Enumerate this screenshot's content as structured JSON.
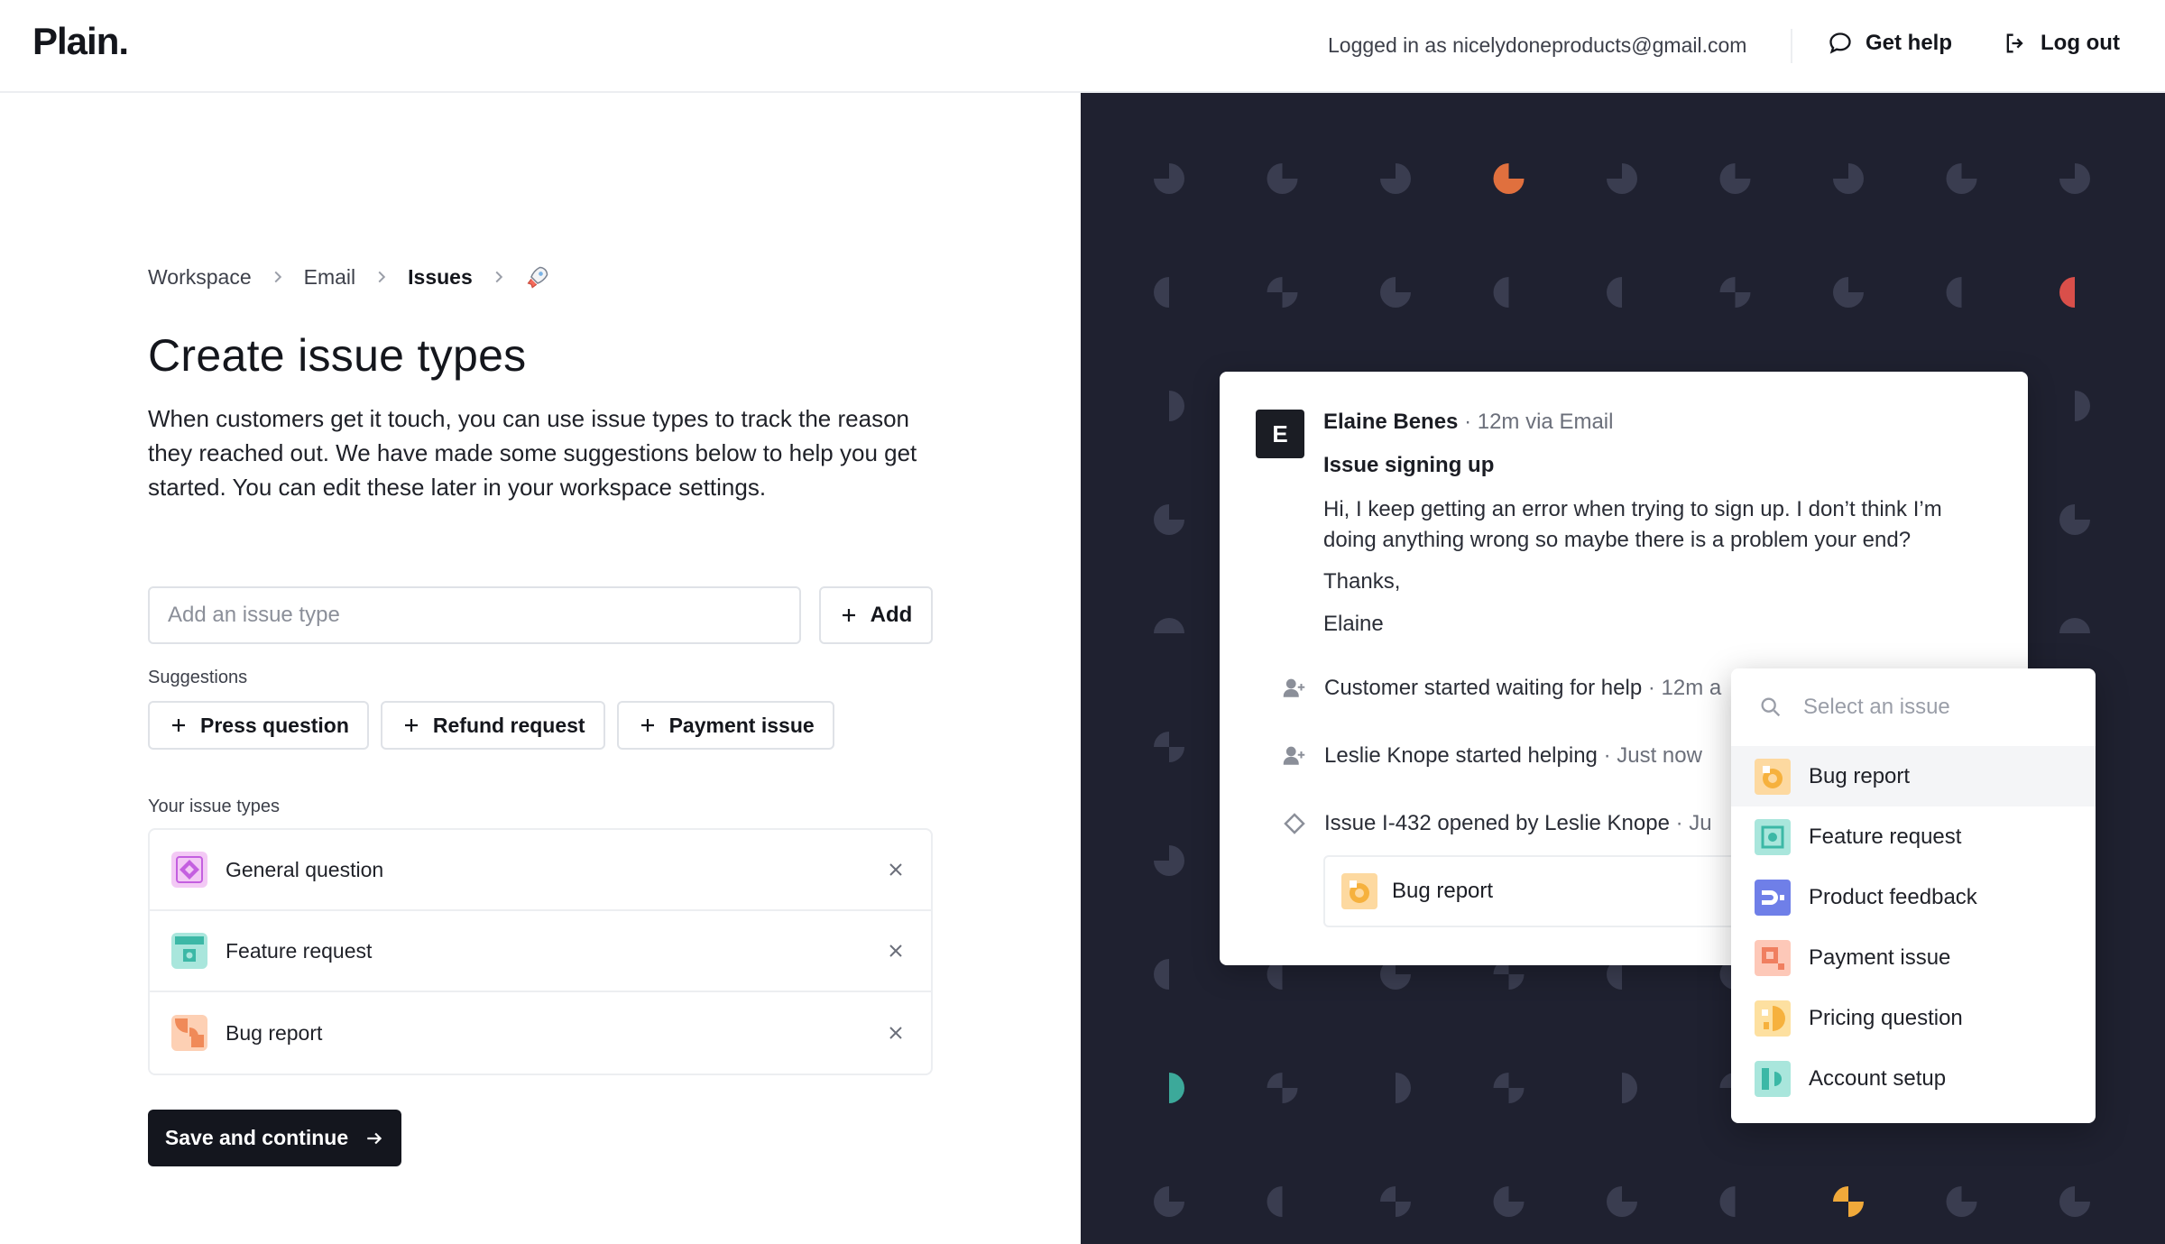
{
  "header": {
    "logo": "Plain.",
    "logged_in": "Logged in as nicelydoneproducts@gmail.com",
    "help_label": "Get help",
    "logout_label": "Log out"
  },
  "breadcrumb": {
    "items": [
      "Workspace",
      "Email",
      "Issues"
    ],
    "last_icon": "rocket-icon"
  },
  "main": {
    "title": "Create issue types",
    "description": "When customers get it touch, you can use issue types to track the reason they reached out. We have made some suggestions below to help you get started. You can edit these later in your workspace settings.",
    "input_placeholder": "Add an issue type",
    "add_label": "Add",
    "suggestions_label": "Suggestions",
    "suggestions": [
      "Press question",
      "Refund request",
      "Payment issue"
    ],
    "your_types_label": "Your issue types",
    "types": [
      {
        "label": "General question",
        "color": "#f3c9f5",
        "accent": "#c45fe0"
      },
      {
        "label": "Feature request",
        "color": "#a9e6dc",
        "accent": "#3cb8a6"
      },
      {
        "label": "Bug report",
        "color": "#fdd0b4",
        "accent": "#f08a58"
      }
    ],
    "save_label": "Save and continue"
  },
  "conversation": {
    "avatar_letter": "E",
    "sender": "Elaine Benes",
    "sender_meta": "· 12m via Email",
    "subject": "Issue signing up",
    "body": [
      "Hi, I keep getting an error when trying to sign up. I don’t think I’m doing anything wrong so maybe there is a problem your end?",
      "Thanks,",
      "Elaine"
    ],
    "timeline": [
      {
        "text": "Customer started waiting for help",
        "meta": "· 12m a",
        "icon": "user-plus-icon"
      },
      {
        "text": "Leslie Knope started helping",
        "meta": "· Just now",
        "icon": "user-plus-icon"
      },
      {
        "text": "Issue I-432 opened by Leslie Knope",
        "meta": "· Ju",
        "icon": "diamond-icon"
      }
    ],
    "issue_pill": "Bug report"
  },
  "dropdown": {
    "placeholder": "Select an issue",
    "items": [
      {
        "label": "Bug report",
        "color": "#fdd9a0",
        "accent": "#f6b13d"
      },
      {
        "label": "Feature request",
        "color": "#a9e6dc",
        "accent": "#3cb8a6"
      },
      {
        "label": "Product feedback",
        "color": "#6f7fe8",
        "accent": "#ffffff"
      },
      {
        "label": "Payment issue",
        "color": "#fdc8b8",
        "accent": "#f07f60"
      },
      {
        "label": "Pricing question",
        "color": "#fde0a0",
        "accent": "#f6b13d"
      },
      {
        "label": "Account setup",
        "color": "#a9e6dc",
        "accent": "#3cb8a6"
      }
    ]
  },
  "colors": {
    "dark_panel": "#1f2130",
    "primary_button": "#14161e",
    "border": "#dfe2e7"
  }
}
